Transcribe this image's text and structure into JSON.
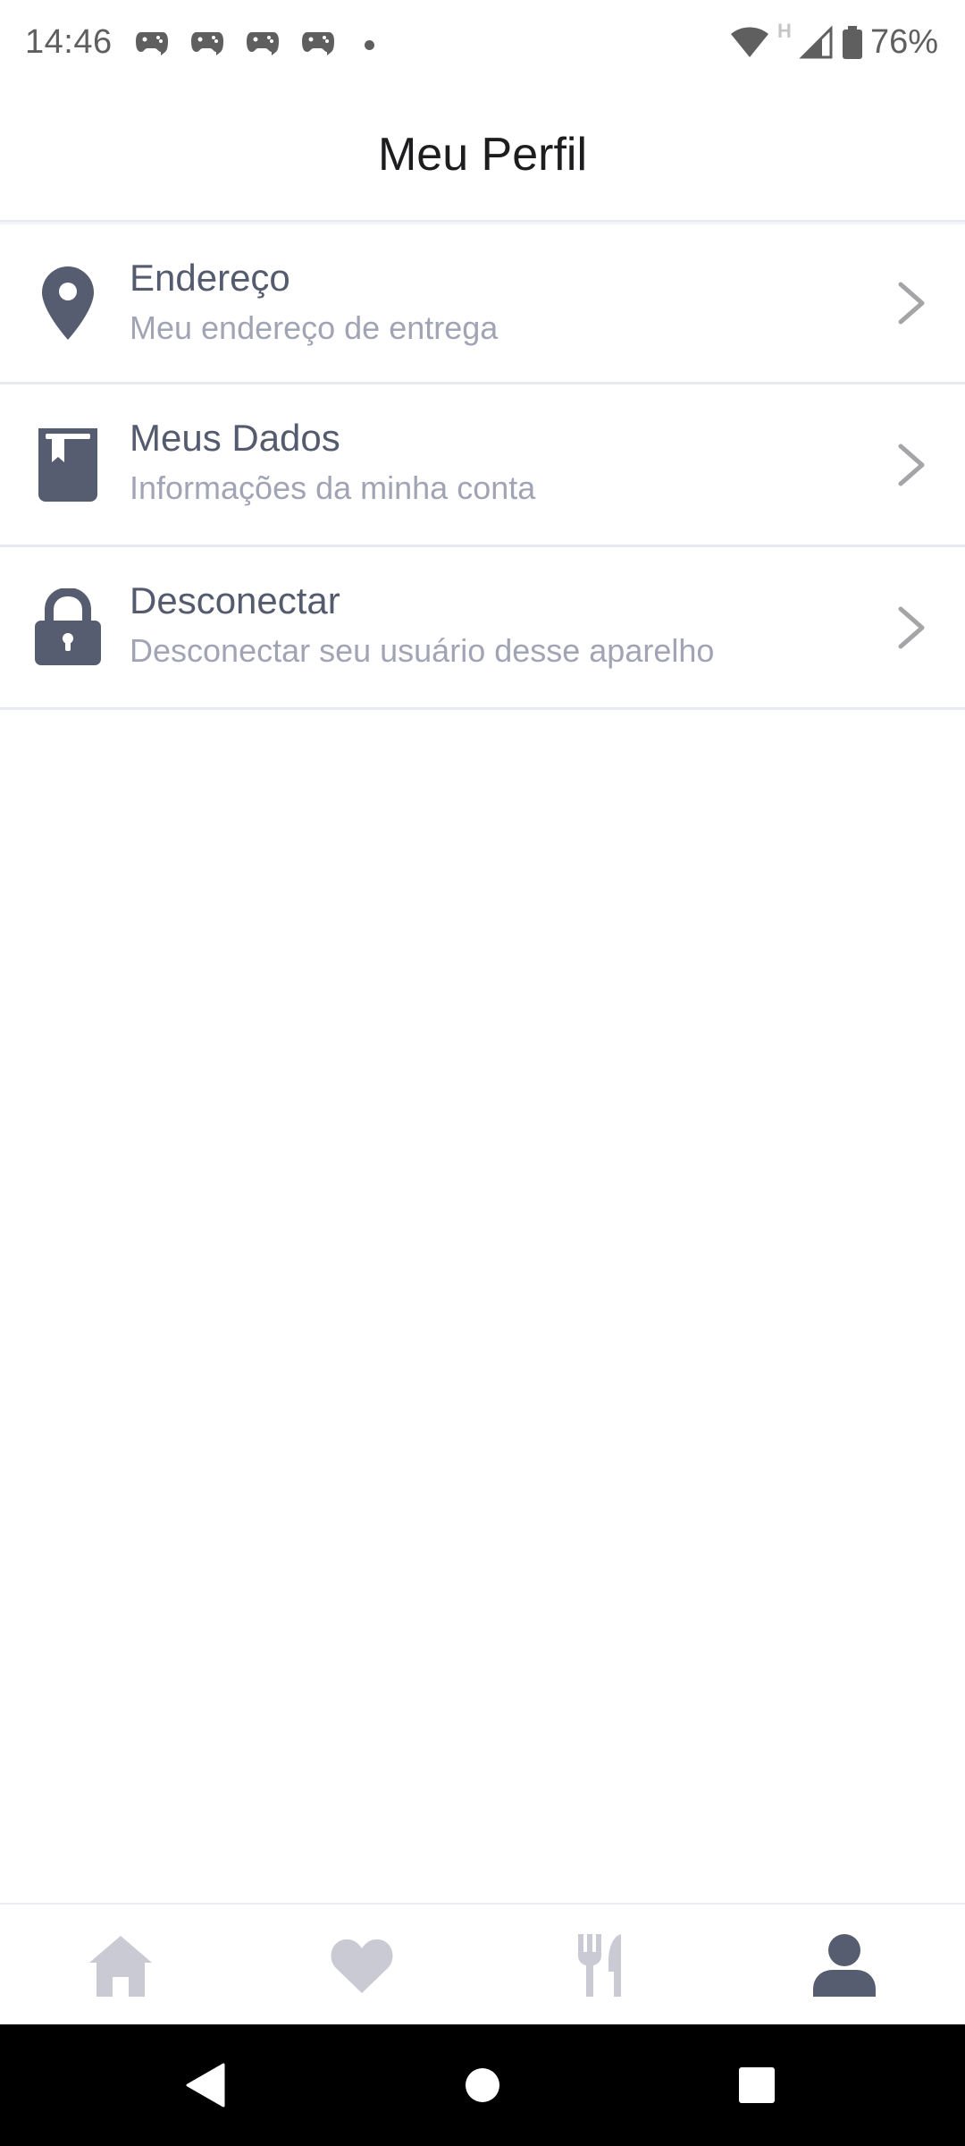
{
  "status_bar": {
    "time": "14:46",
    "battery_percent": "76%",
    "notification_icons": [
      "game-controller-chat-icon",
      "game-controller-chat-icon",
      "game-controller-chat-icon",
      "game-controller-chat-icon"
    ],
    "network_type": "H"
  },
  "header": {
    "title": "Meu Perfil"
  },
  "menu": {
    "items": [
      {
        "title": "Endereço",
        "subtitle": "Meu endereço de entrega",
        "icon": "map-pin-icon"
      },
      {
        "title": "Meus Dados",
        "subtitle": "Informações da minha conta",
        "icon": "book-icon"
      },
      {
        "title": "Desconectar",
        "subtitle": "Desconectar seu usuário desse aparelho",
        "icon": "lock-icon"
      }
    ]
  },
  "bottom_nav": {
    "items": [
      {
        "icon": "home-icon",
        "active": false
      },
      {
        "icon": "heart-icon",
        "active": false
      },
      {
        "icon": "utensils-icon",
        "active": false
      },
      {
        "icon": "user-icon",
        "active": true
      }
    ]
  },
  "colors": {
    "icon_active": "#575d70",
    "icon_inactive": "#c9cad3",
    "title_text": "#555b6e",
    "subtitle_text": "#a1a4b4",
    "chevron": "#a5a5a8",
    "divider": "#e8eaf3"
  }
}
